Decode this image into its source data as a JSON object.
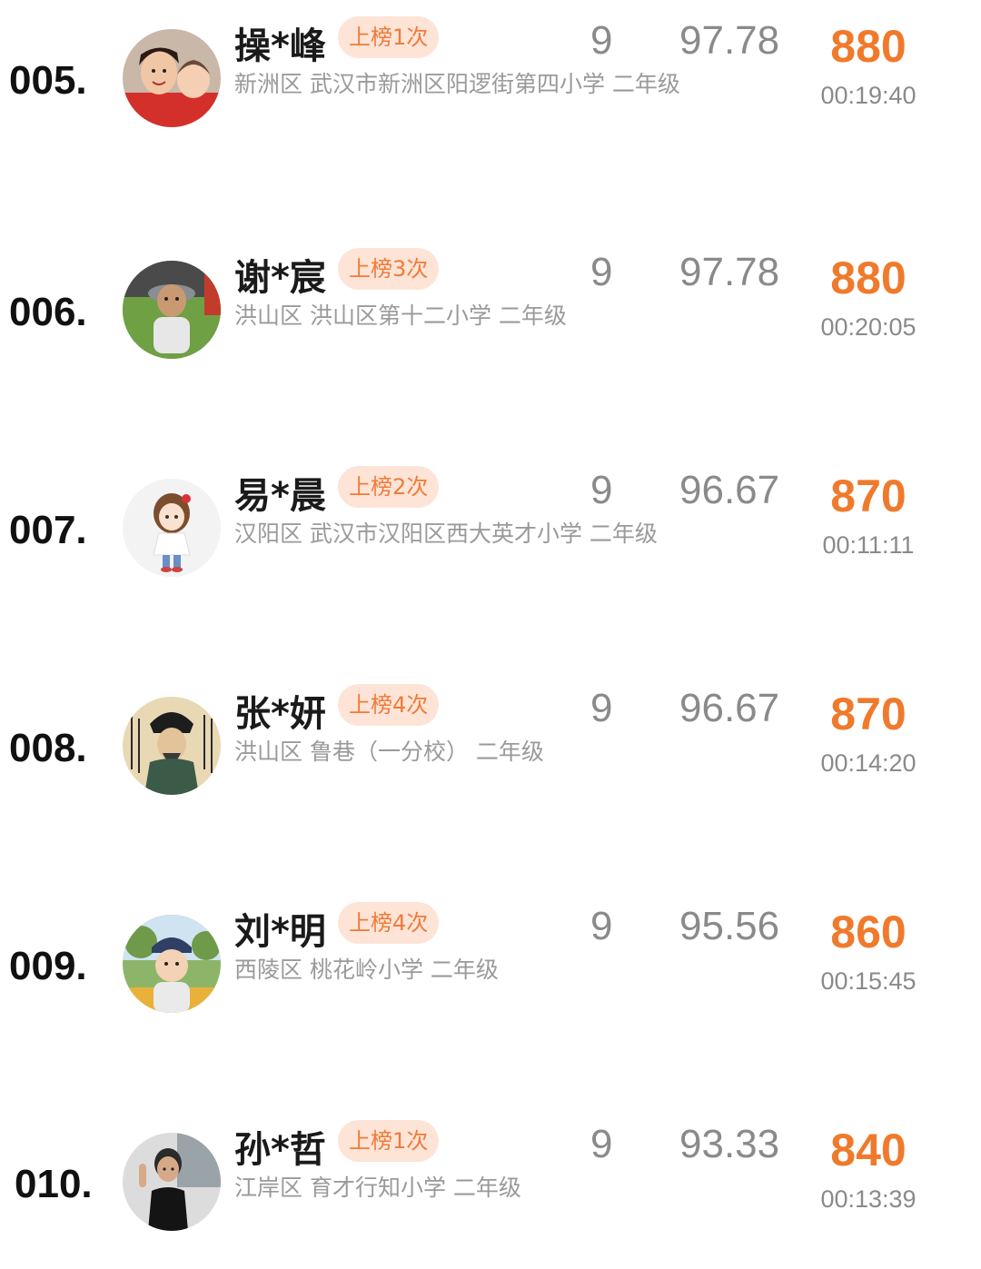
{
  "rows": [
    {
      "rank": "005.",
      "name": "操*峰",
      "badge": "上榜1次",
      "count": "9",
      "accuracy": "97.78",
      "school": "新洲区 武汉市新洲区阳逻街第四小学 二年级",
      "score": "880",
      "time": "00:19:40",
      "avatar_icon": "avatar-photo-mother-child"
    },
    {
      "rank": "006.",
      "name": "谢*宸",
      "badge": "上榜3次",
      "count": "9",
      "accuracy": "97.78",
      "school": "洪山区 洪山区第十二小学 二年级",
      "score": "880",
      "time": "00:20:05",
      "avatar_icon": "avatar-photo-child-on-grass"
    },
    {
      "rank": "007.",
      "name": "易*晨",
      "badge": "上榜2次",
      "count": "9",
      "accuracy": "96.67",
      "school": "汉阳区 武汉市汉阳区西大英才小学 二年级",
      "score": "870",
      "time": "00:11:11",
      "avatar_icon": "avatar-cartoon-girl"
    },
    {
      "rank": "008.",
      "name": "张*妍",
      "badge": "上榜4次",
      "count": "9",
      "accuracy": "96.67",
      "school": "洪山区 鲁巷（一分校） 二年级",
      "score": "870",
      "time": "00:14:20",
      "avatar_icon": "avatar-ancient-portrait"
    },
    {
      "rank": "009.",
      "name": "刘*明",
      "badge": "上榜4次",
      "count": "9",
      "accuracy": "95.56",
      "school": "西陵区 桃花岭小学 二年级",
      "score": "860",
      "time": "00:15:45",
      "avatar_icon": "avatar-photo-child-cap"
    },
    {
      "rank": "010.",
      "name": "孙*哲",
      "badge": "上榜1次",
      "count": "9",
      "accuracy": "93.33",
      "school": "江岸区 育才行知小学 二年级",
      "score": "840",
      "time": "00:13:39",
      "avatar_icon": "avatar-photo-boy-black-shirt"
    }
  ],
  "colors": {
    "score": "#f07a2c",
    "badge_bg": "#fde4d6",
    "badge_text": "#f07a3a",
    "muted": "#8a8a8a"
  }
}
